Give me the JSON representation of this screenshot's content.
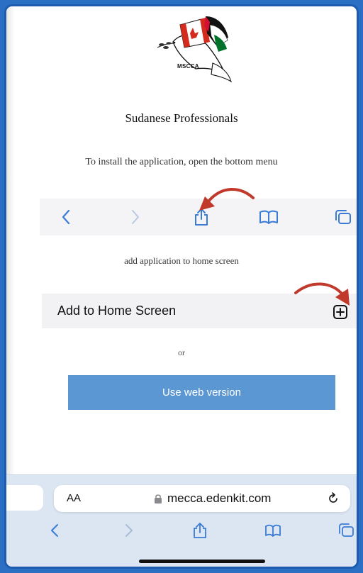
{
  "logo": {
    "text": "MSCCA"
  },
  "page": {
    "title": "Sudanese Professionals",
    "install_instruction": "To install the application, open the bottom menu",
    "step2_instruction": "add application to home screen",
    "add_to_home_label": "Add to Home Screen",
    "or_text": "or",
    "web_version_button": "Use web version"
  },
  "browser": {
    "text_size_label": "AA",
    "url": "mecca.edenkit.com"
  },
  "icons": [
    "back-icon",
    "forward-icon",
    "share-icon",
    "bookmarks-icon",
    "tabs-icon",
    "add-square-icon",
    "lock-icon",
    "reload-icon",
    "curved-arrow-icon"
  ],
  "colors": {
    "accent_blue": "#5b97d2",
    "ios_blue": "#3a7bd5",
    "arrow_red": "#c0392b",
    "chrome_bg": "#dbe6f2"
  }
}
